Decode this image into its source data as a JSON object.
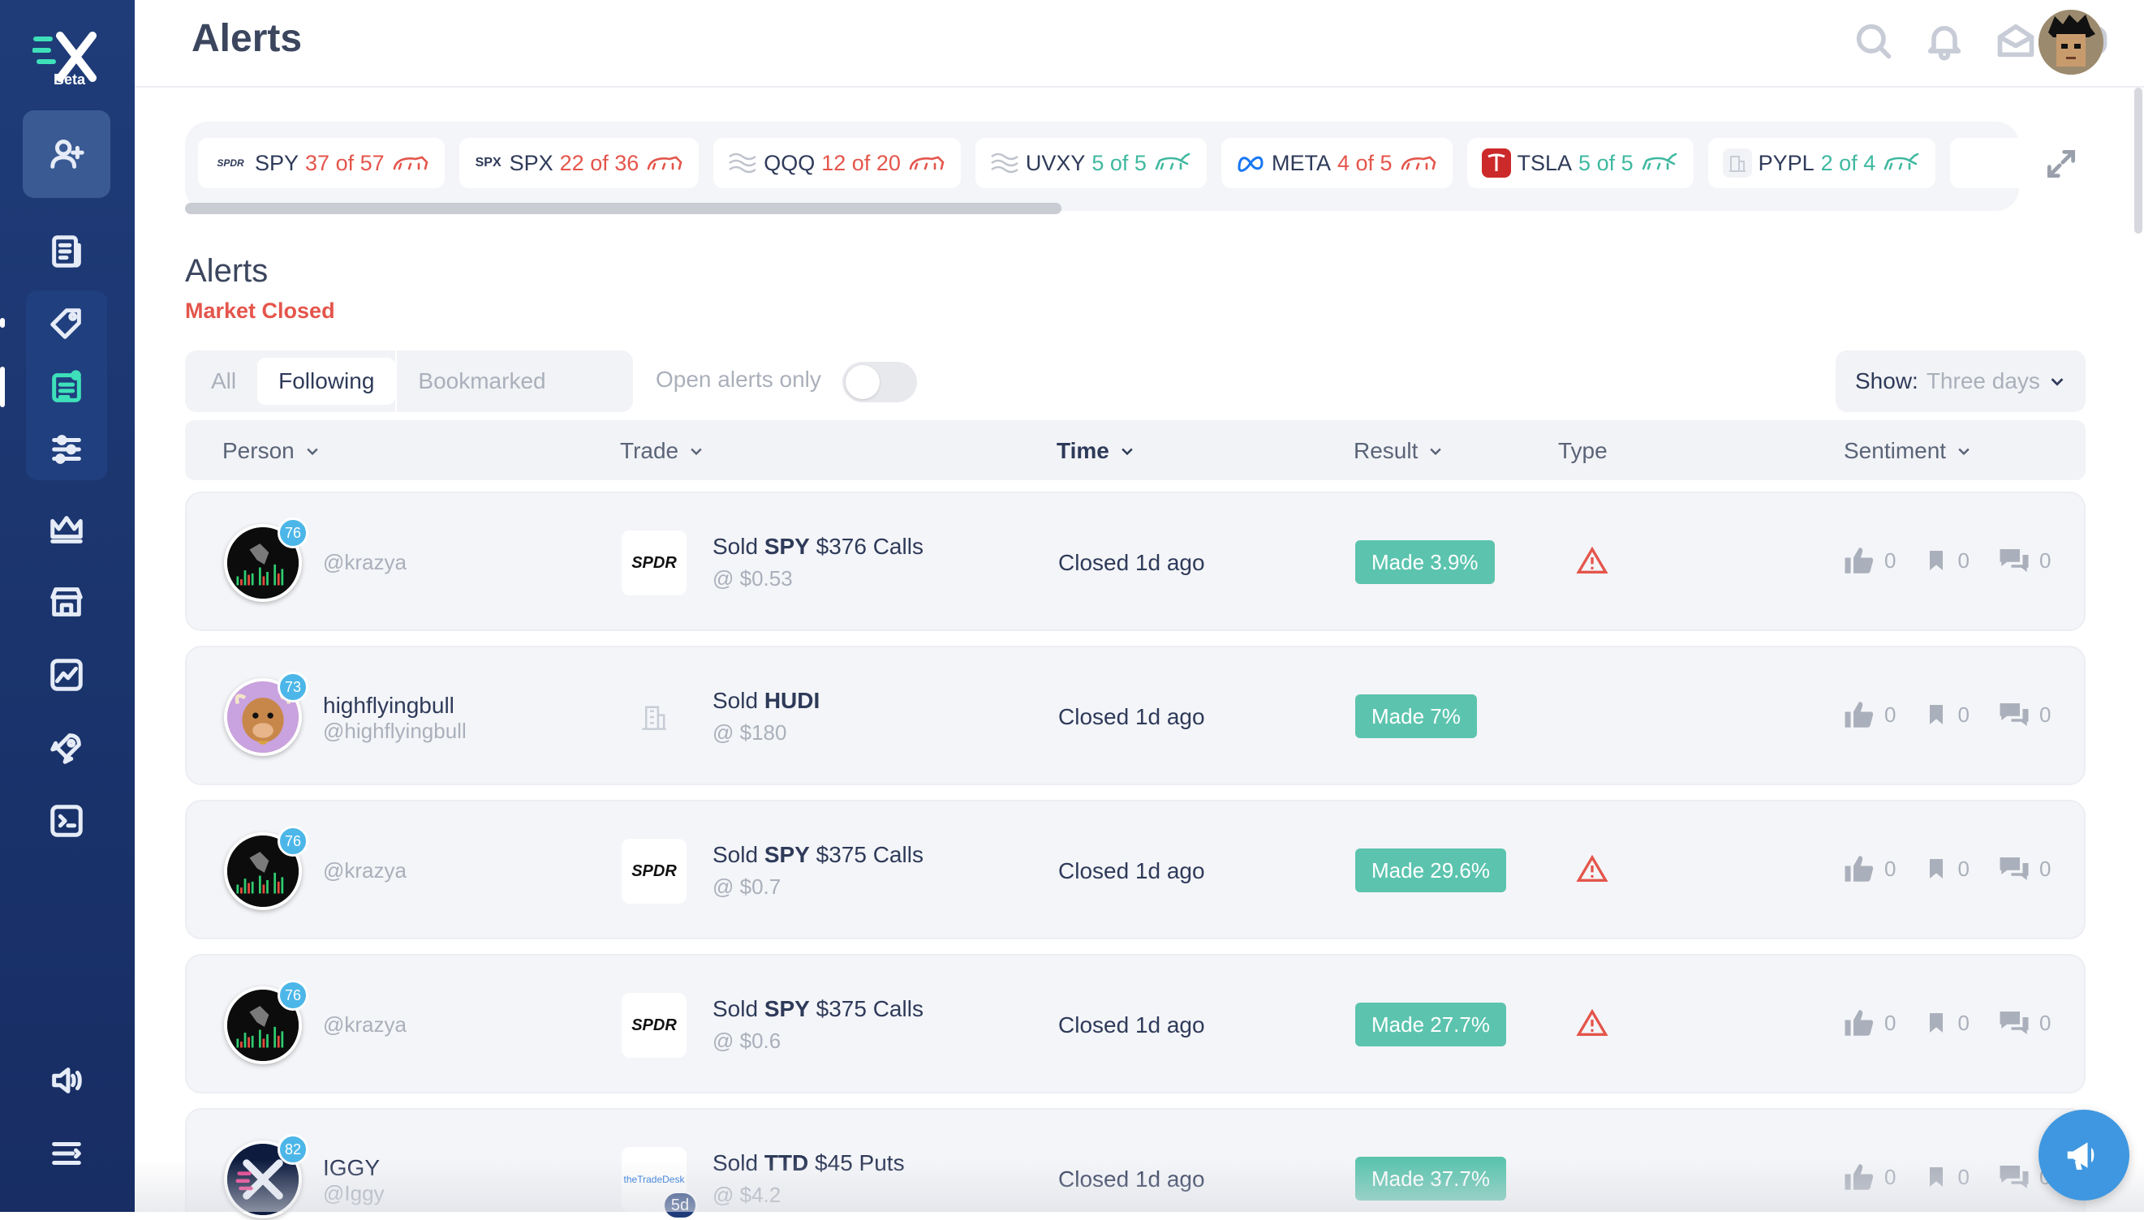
{
  "app": {
    "logo_badge": "Beta"
  },
  "header": {
    "title": "Alerts"
  },
  "tickers": [
    {
      "logo": "SPDR",
      "symbol": "SPY",
      "count": "37 of 57",
      "trend": "bear"
    },
    {
      "logo": "SPX",
      "symbol": "SPX",
      "count": "22 of 36",
      "trend": "bear"
    },
    {
      "logo": "",
      "symbol": "QQQ",
      "count": "12 of 20",
      "trend": "bear"
    },
    {
      "logo": "",
      "symbol": "UVXY",
      "count": "5 of 5",
      "trend": "bull"
    },
    {
      "logo": "",
      "symbol": "META",
      "count": "4 of 5",
      "trend": "bear"
    },
    {
      "logo": "",
      "symbol": "TSLA",
      "count": "5 of 5",
      "trend": "bull"
    },
    {
      "logo": "",
      "symbol": "PYPL",
      "count": "2 of 4",
      "trend": "bull"
    }
  ],
  "section": {
    "title": "Alerts",
    "market_status": "Market Closed"
  },
  "filters": {
    "tabs": [
      "All",
      "Following",
      "Bookmarked"
    ],
    "active_tab": "Following",
    "open_only_label": "Open alerts only",
    "show_label": "Show:",
    "show_value": "Three days"
  },
  "columns": {
    "person": "Person",
    "trade": "Trade",
    "time": "Time",
    "result": "Result",
    "type": "Type",
    "sentiment": "Sentiment"
  },
  "rows": [
    {
      "name": "",
      "handle": "@krazya",
      "score": "76",
      "ticker_logo": "SPDR",
      "trade_prefix": "Sold",
      "trade_symbol": "SPY",
      "trade_suffix": "$376 Calls",
      "price": "@ $0.53",
      "time": "Closed 1d ago",
      "result": "Made 3.9%",
      "warning": true,
      "likes": "0",
      "bookmarks": "0",
      "comments": "0"
    },
    {
      "name": "highflyingbull",
      "handle": "@highflyingbull",
      "score": "73",
      "ticker_logo": "",
      "trade_prefix": "Sold",
      "trade_symbol": "HUDI",
      "trade_suffix": "",
      "price": "@ $180",
      "time": "Closed 1d ago",
      "result": "Made 7%",
      "warning": false,
      "likes": "0",
      "bookmarks": "0",
      "comments": "0"
    },
    {
      "name": "",
      "handle": "@krazya",
      "score": "76",
      "ticker_logo": "SPDR",
      "trade_prefix": "Sold",
      "trade_symbol": "SPY",
      "trade_suffix": "$375 Calls",
      "price": "@ $0.7",
      "time": "Closed 1d ago",
      "result": "Made 29.6%",
      "warning": true,
      "likes": "0",
      "bookmarks": "0",
      "comments": "0"
    },
    {
      "name": "",
      "handle": "@krazya",
      "score": "76",
      "ticker_logo": "SPDR",
      "trade_prefix": "Sold",
      "trade_symbol": "SPY",
      "trade_suffix": "$375 Calls",
      "price": "@ $0.6",
      "time": "Closed 1d ago",
      "result": "Made 27.7%",
      "warning": true,
      "likes": "0",
      "bookmarks": "0",
      "comments": "0"
    },
    {
      "name": "IGGY",
      "handle": "@Iggy",
      "score": "82",
      "ticker_logo": "theTradeDesk",
      "trade_badge": "5d",
      "trade_prefix": "Sold",
      "trade_symbol": "TTD",
      "trade_suffix": "$45 Puts",
      "price": "@ $4.2",
      "time": "Closed 1d ago",
      "result": "Made 37.7%",
      "warning": false,
      "likes": "0",
      "bookmarks": "0",
      "comments": "0"
    }
  ],
  "colors": {
    "sidebar": "#1f3c79",
    "bear": "#e4554b",
    "bull": "#3fb8a0",
    "result_badge": "#5cc4ae",
    "score_badge": "#4cb6e8"
  }
}
